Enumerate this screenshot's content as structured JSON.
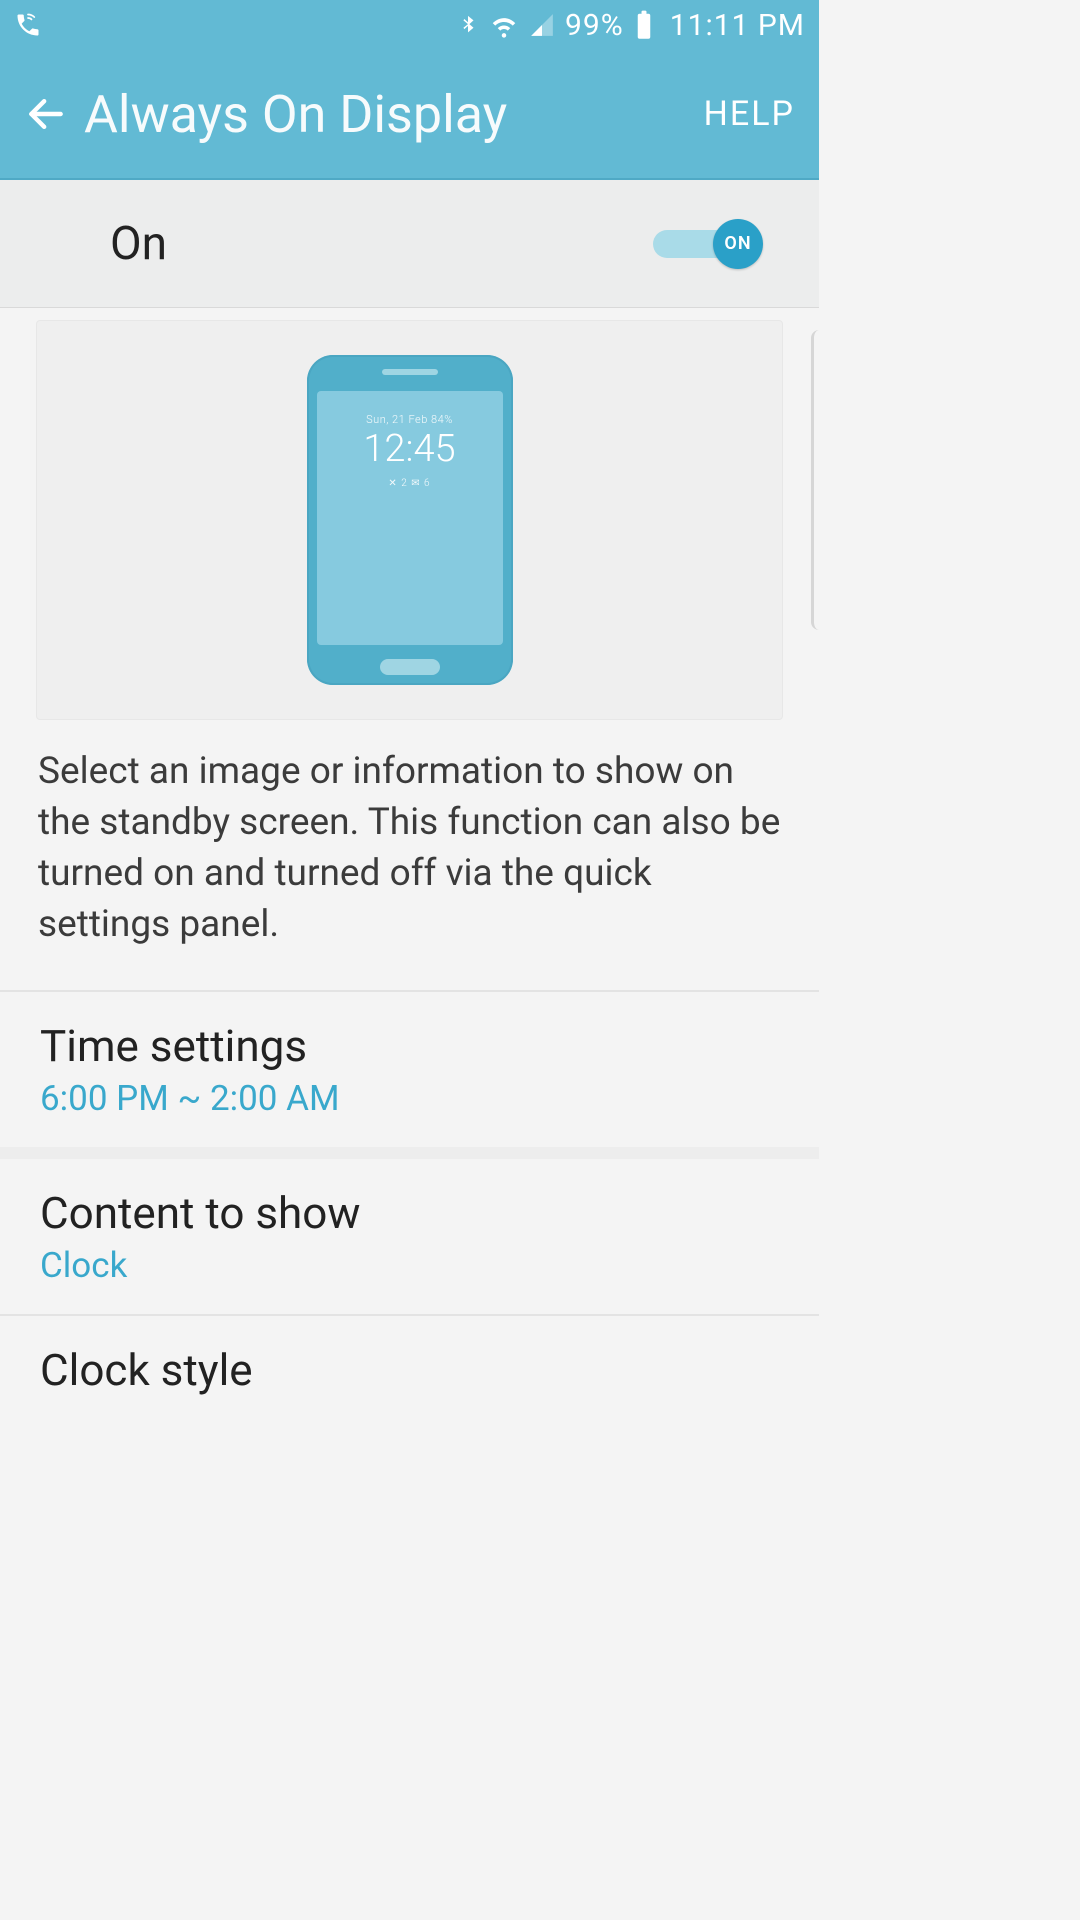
{
  "statusbar": {
    "battery_pct": "99%",
    "time": "11:11 PM"
  },
  "appbar": {
    "title": "Always On Display",
    "help": "HELP"
  },
  "master_toggle": {
    "label": "On",
    "knob_text": "ON",
    "state": "on"
  },
  "preview": {
    "line1": "Sun, 21 Feb  84%",
    "line2": "12:45",
    "line3": "✕ 2   ✉ 6"
  },
  "description": "Select an image or information to show on the standby screen. This function can also be turned on and turned off via the quick settings panel.",
  "settings": {
    "time_settings": {
      "title": "Time settings",
      "value": "6:00 PM ~ 2:00 AM"
    },
    "content_to_show": {
      "title": "Content to show",
      "value": "Clock"
    },
    "clock_style": {
      "title": "Clock style"
    }
  }
}
